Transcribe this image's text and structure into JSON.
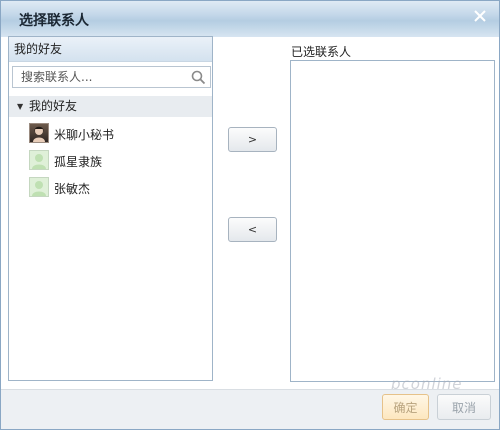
{
  "window": {
    "title": "选择联系人"
  },
  "left_panel": {
    "header": "我的好友",
    "search_placeholder": "搜索联系人...",
    "group": {
      "label": "我的好友",
      "expanded": true
    },
    "contacts": [
      {
        "name": "米聊小秘书",
        "avatar": "photo-avatar"
      },
      {
        "name": "孤星隶族",
        "avatar": "default-avatar"
      },
      {
        "name": "张敏杰",
        "avatar": "default-avatar"
      }
    ]
  },
  "move_buttons": {
    "add": ">",
    "remove": "<"
  },
  "right_panel": {
    "label": "已选联系人",
    "selected": []
  },
  "footer": {
    "ok": "确定",
    "cancel": "取消"
  },
  "watermark": "pconline",
  "icons": {
    "close": "close-icon",
    "search": "search-icon",
    "expand": "triangle-down-icon"
  },
  "colors": {
    "title_bar": "#c6d9ea",
    "panel_border": "#9fb4c8",
    "ok_border": "#e6c28a"
  }
}
